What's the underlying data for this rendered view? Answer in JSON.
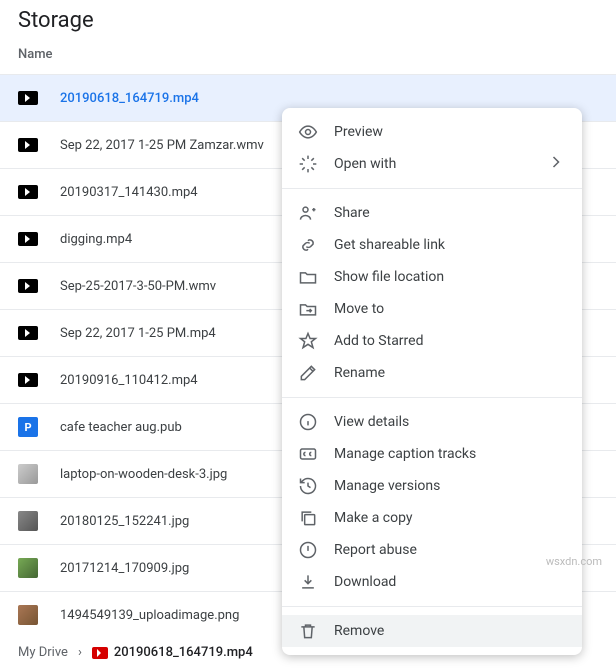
{
  "pageTitle": "Storage",
  "nameHeader": "Name",
  "files": [
    {
      "name": "20190618_164719.mp4",
      "icon": "video",
      "selected": true
    },
    {
      "name": "Sep 22, 2017 1-25 PM Zamzar.wmv",
      "icon": "video"
    },
    {
      "name": "20190317_141430.mp4",
      "icon": "video"
    },
    {
      "name": "digging.mp4",
      "icon": "video"
    },
    {
      "name": "Sep-25-2017-3-50-PM.wmv",
      "icon": "video"
    },
    {
      "name": "Sep 22, 2017 1-25 PM.mp4",
      "icon": "video"
    },
    {
      "name": "20190916_110412.mp4",
      "icon": "video"
    },
    {
      "name": "cafe teacher aug.pub",
      "icon": "pub"
    },
    {
      "name": "laptop-on-wooden-desk-3.jpg",
      "icon": "jpg1"
    },
    {
      "name": "20180125_152241.jpg",
      "icon": "jpg2"
    },
    {
      "name": "20171214_170909.jpg",
      "icon": "jpg3"
    },
    {
      "name": "1494549139_uploadimage.png",
      "icon": "png"
    }
  ],
  "contextMenu": {
    "preview": "Preview",
    "openWith": "Open with",
    "share": "Share",
    "getLink": "Get shareable link",
    "showLocation": "Show file location",
    "moveTo": "Move to",
    "addStarred": "Add to Starred",
    "rename": "Rename",
    "viewDetails": "View details",
    "captions": "Manage caption tracks",
    "versions": "Manage versions",
    "copy": "Make a copy",
    "report": "Report abuse",
    "download": "Download",
    "remove": "Remove"
  },
  "breadcrumb": {
    "root": "My Drive",
    "current": "20190618_164719.mp4"
  },
  "watermark": "wsxdn.com"
}
